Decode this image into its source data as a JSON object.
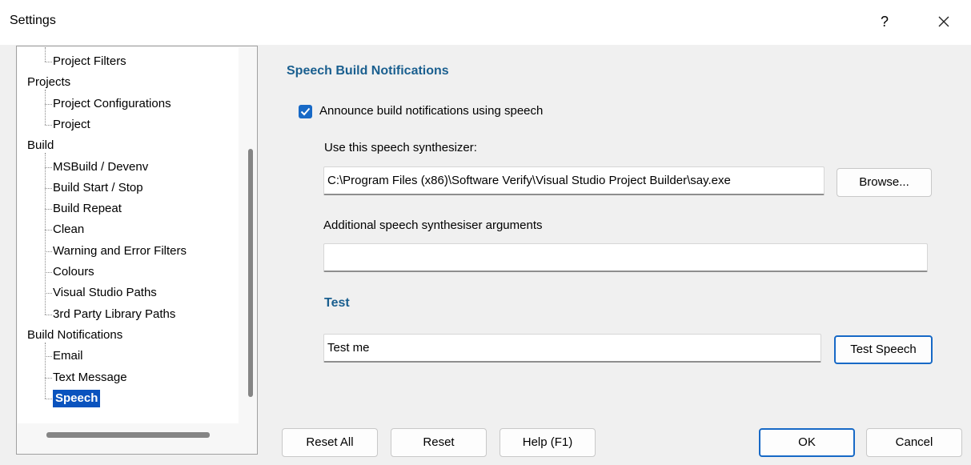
{
  "window": {
    "title": "Settings",
    "help_label": "?"
  },
  "tree": {
    "items": [
      {
        "label": "Project Filters",
        "level": 1
      },
      {
        "label": "Projects",
        "level": 0
      },
      {
        "label": "Project Configurations",
        "level": 1
      },
      {
        "label": "Project",
        "level": 1
      },
      {
        "label": "Build",
        "level": 0
      },
      {
        "label": "MSBuild / Devenv",
        "level": 1
      },
      {
        "label": "Build Start / Stop",
        "level": 1
      },
      {
        "label": "Build Repeat",
        "level": 1
      },
      {
        "label": "Clean",
        "level": 1
      },
      {
        "label": "Warning and Error Filters",
        "level": 1
      },
      {
        "label": "Colours",
        "level": 1
      },
      {
        "label": "Visual Studio Paths",
        "level": 1
      },
      {
        "label": "3rd Party Library Paths",
        "level": 1
      },
      {
        "label": "Build Notifications",
        "level": 0
      },
      {
        "label": "Email",
        "level": 1
      },
      {
        "label": "Text Message",
        "level": 1
      },
      {
        "label": "Speech",
        "level": 1,
        "selected": true
      }
    ]
  },
  "speech": {
    "section_title": "Speech Build Notifications",
    "announce_label": "Announce build notifications using speech",
    "announce_checked": true,
    "synth_label": "Use this speech synthesizer:",
    "synth_path": "C:\\Program Files (x86)\\Software Verify\\Visual Studio Project Builder\\say.exe",
    "browse_label": "Browse...",
    "args_label": "Additional speech synthesiser arguments",
    "args_value": "",
    "test_title": "Test",
    "test_text": "Test me",
    "test_button": "Test Speech"
  },
  "footer": {
    "reset_all": "Reset All",
    "reset": "Reset",
    "help": "Help (F1)",
    "ok": "OK",
    "cancel": "Cancel"
  },
  "colors": {
    "accent": "#1769c6",
    "section_title": "#1a5f8f",
    "selection": "#0a53be"
  }
}
